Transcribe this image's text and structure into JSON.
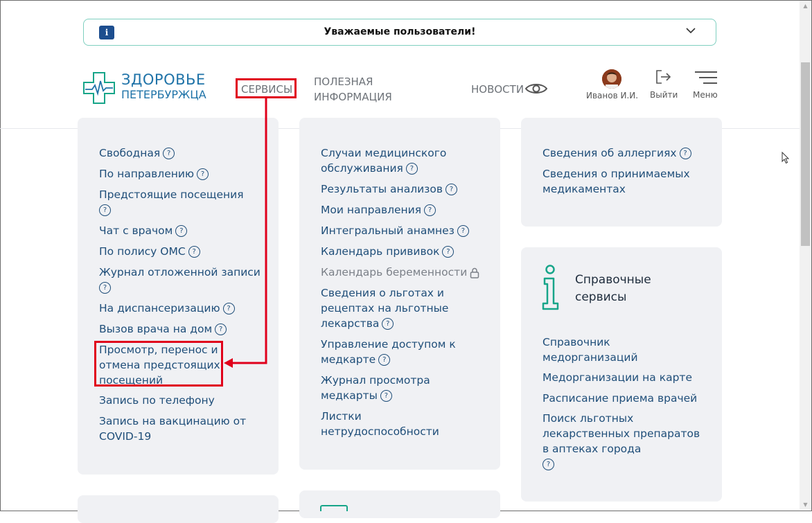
{
  "notice": {
    "icon_letter": "i",
    "title": "Уважаемые пользователи!"
  },
  "header": {
    "logo_line1": "ЗДОРОВЬЕ",
    "logo_line2": "ПЕТЕРБУРЖЦА",
    "nav_services": "СЕРВИСЫ",
    "nav_info_line1": "ПОЛЕЗНАЯ",
    "nav_info_line2": "ИНФОРМАЦИЯ",
    "nav_news": "НОВОСТИ",
    "user_name": "Иванов И.И.",
    "logout_label": "Выйти",
    "menu_label": "Меню"
  },
  "col1": {
    "l0": "Свободная",
    "l1": "По направлению",
    "l2": "Предстоящие посещения",
    "l3": "Чат с врачом",
    "l4": "По полису ОМС",
    "l5": "Журнал отложенной записи",
    "l6": "На диспансеризацию",
    "l7": "Вызов врача на дом",
    "l8a": "Просмотр, перенос и",
    "l8b": "отмена предстоящих",
    "l8c": "посещений",
    "l9": "Запись по телефону",
    "l10a": "Запись на вакцинацию от",
    "l10b": "COVID-19"
  },
  "col2": {
    "l0a": "Случаи медицинского",
    "l0b": "обслуживания",
    "l1": "Результаты анализов",
    "l2": "Мои направления",
    "l3": "Интегральный анамнез",
    "l4": "Календарь прививок",
    "l5": "Календарь беременности",
    "l6a": "Сведения о льготах и",
    "l6b": "рецептах на льготные",
    "l6c": "лекарства",
    "l7a": "Управление доступом к",
    "l7b": "медкарте",
    "l8a": "Журнал просмотра",
    "l8b": "медкарты",
    "l9a": "Листки",
    "l9b": "нетрудоспособности"
  },
  "col3": {
    "l0": "Сведения об аллергиях",
    "l1a": "Сведения о принимаемых",
    "l1b": "медикаментах"
  },
  "reference": {
    "title_line1": "Справочные",
    "title_line2": "сервисы",
    "l0a": "Справочник",
    "l0b": "медорганизаций",
    "l1": "Медорганизации на карте",
    "l2": "Расписание приема врачей",
    "l3a": "Поиск льготных",
    "l3b": "лекарственных препаратов",
    "l3c": "в аптеках города"
  },
  "help_mark": "?",
  "colors": {
    "link": "#1f4e79",
    "accent_teal": "#17a589",
    "highlight_red": "#e0001b",
    "card_bg": "#f0f1f4"
  }
}
